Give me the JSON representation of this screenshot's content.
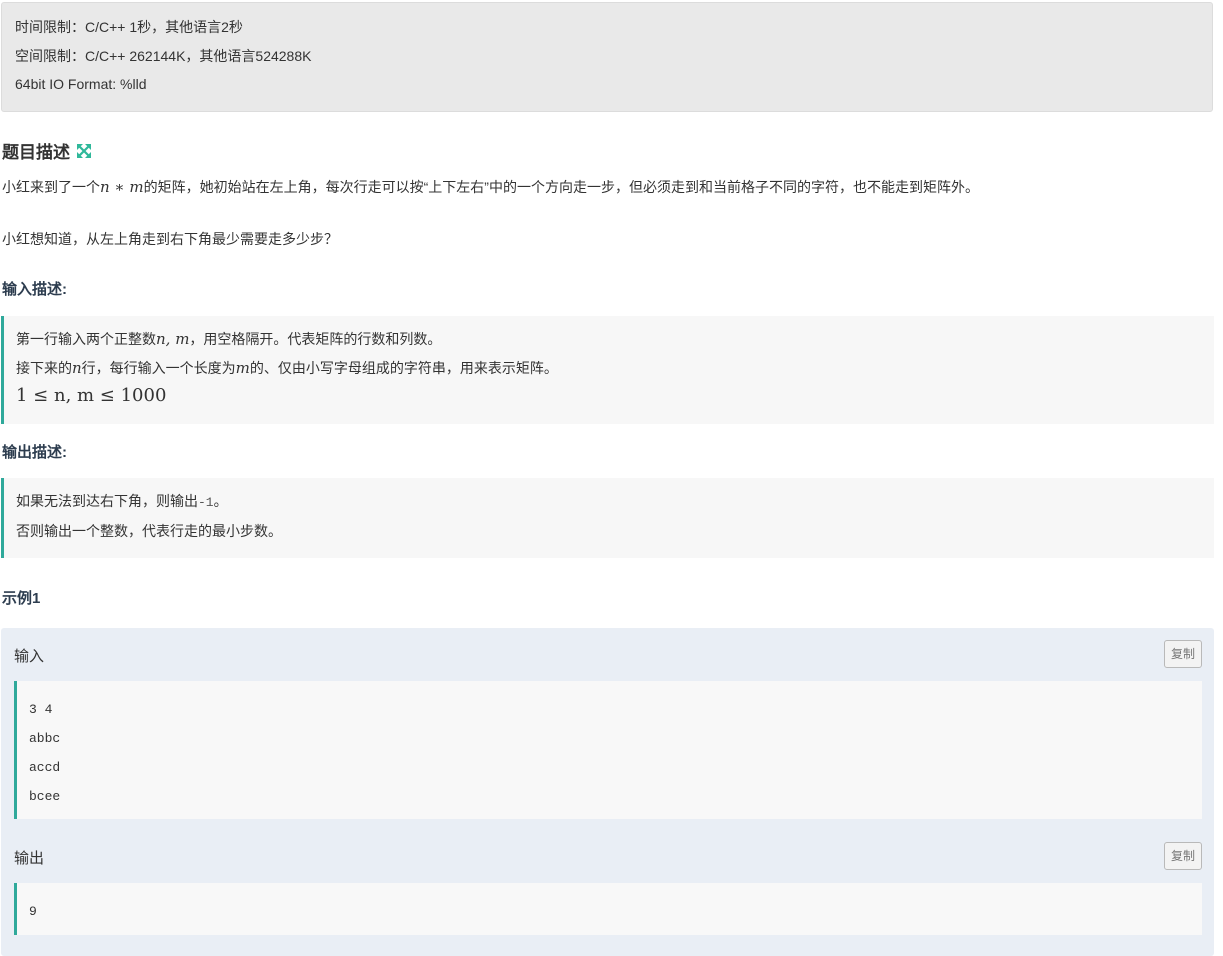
{
  "limits": {
    "time": "时间限制：C/C++ 1秒，其他语言2秒",
    "space": "空间限制：C/C++ 262144K，其他语言524288K",
    "io_format": "64bit IO Format: %lld"
  },
  "description": {
    "title": "题目描述",
    "expand_icon": "expand-icon",
    "para1_before": "小红来到了一个",
    "para1_math": "n ∗ m",
    "para1_after": "的矩阵，她初始站在左上角，每次行走可以按“上下左右”中的一个方向走一步，但必须走到和当前格子不同的字符，也不能走到矩阵外。",
    "para2": "小红想知道，从左上角走到右下角最少需要走多少步？"
  },
  "input_desc": {
    "title": "输入描述:",
    "line1_before": "第一行输入两个正整数",
    "line1_math": "n, m",
    "line1_after": "，用空格隔开。代表矩阵的行数和列数。",
    "line2_a": "接下来的",
    "line2_math1": "n",
    "line2_b": "行，每行输入一个长度为",
    "line2_math2": "m",
    "line2_c": "的、仅由小写字母组成的字符串，用来表示矩阵。",
    "constraint": "1 ≤ n, m ≤ 1000"
  },
  "output_desc": {
    "title": "输出描述:",
    "line1_before": "如果无法到达右下角，则输出",
    "line1_code": "-1",
    "line1_after": "。",
    "line2": "否则输出一个整数，代表行走的最小步数。"
  },
  "example": {
    "title": "示例1",
    "input_label": "输入",
    "input_lines": [
      "3 4",
      "abbc",
      "accd",
      "bcee"
    ],
    "output_label": "输出",
    "output_lines": [
      "9"
    ],
    "copy_label": "复制"
  },
  "colors": {
    "accent": "#2fa99b",
    "panel_bg": "#e9eef5",
    "limits_bg": "#e9e9e9"
  }
}
